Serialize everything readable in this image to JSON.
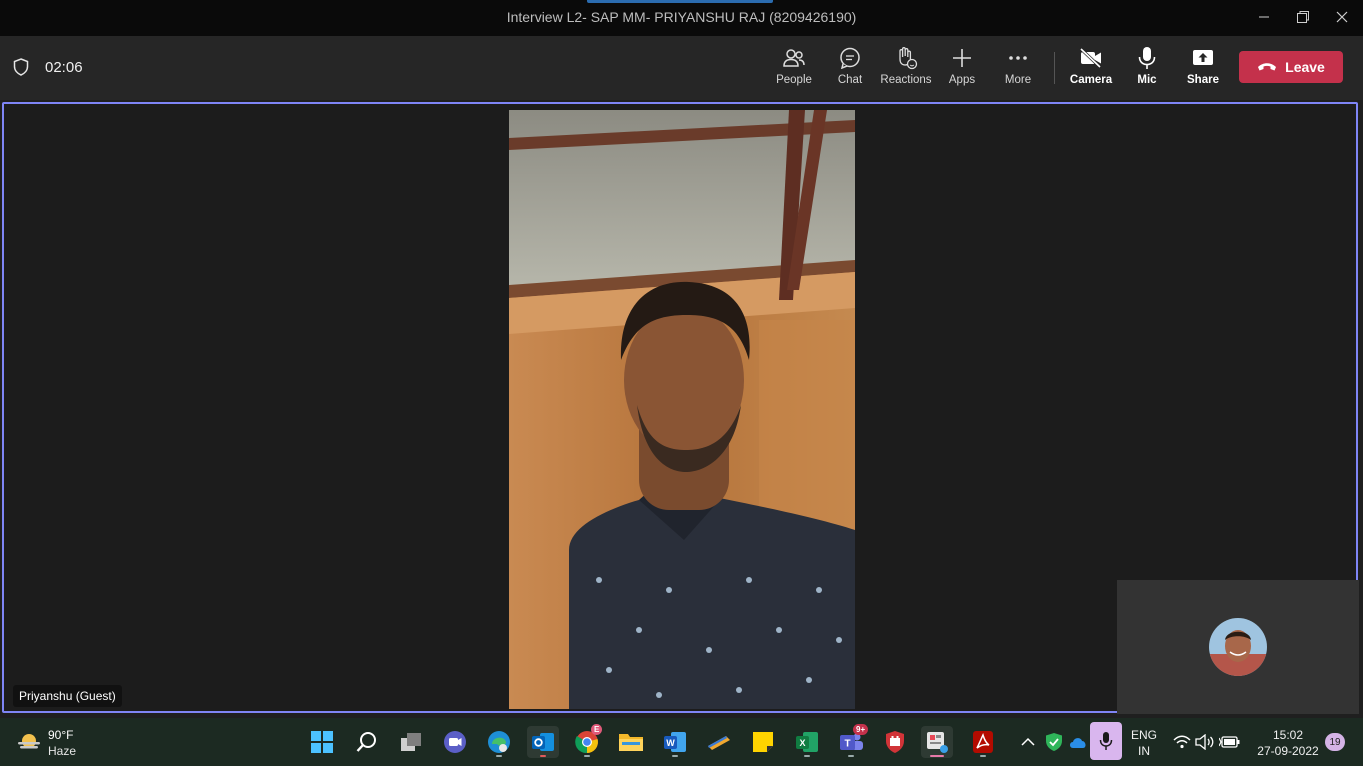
{
  "window": {
    "title": "Interview L2- SAP MM- PRIYANSHU RAJ (8209426190)"
  },
  "toolbar": {
    "timer": "02:06",
    "buttons": [
      {
        "label": "People",
        "icon": "people-icon"
      },
      {
        "label": "Chat",
        "icon": "chat-icon"
      },
      {
        "label": "Reactions",
        "icon": "reactions-icon"
      },
      {
        "label": "Apps",
        "icon": "plus-icon"
      },
      {
        "label": "More",
        "icon": "more-icon"
      }
    ],
    "media": [
      {
        "label": "Camera",
        "icon": "camera-off-icon"
      },
      {
        "label": "Mic",
        "icon": "mic-icon"
      },
      {
        "label": "Share",
        "icon": "share-icon"
      }
    ],
    "leave_label": "Leave",
    "leave_color": "#c4314b"
  },
  "stage": {
    "participant_name": "Priyanshu (Guest)",
    "active_border_color": "#7f85f5"
  },
  "taskbar": {
    "weather": {
      "temp": "90°F",
      "condition": "Haze"
    },
    "apps": [
      {
        "name": "start-button"
      },
      {
        "name": "search-button"
      },
      {
        "name": "task-view-button"
      },
      {
        "name": "teams-chat-button"
      },
      {
        "name": "edge-button"
      },
      {
        "name": "outlook-button"
      },
      {
        "name": "chrome-button",
        "badge": "E"
      },
      {
        "name": "file-explorer-button"
      },
      {
        "name": "word-button"
      },
      {
        "name": "app-button"
      },
      {
        "name": "sticky-notes-button"
      },
      {
        "name": "excel-button"
      },
      {
        "name": "teams-button",
        "badge": "9+"
      },
      {
        "name": "security-button"
      },
      {
        "name": "snipping-tool-button"
      },
      {
        "name": "acrobat-button"
      }
    ],
    "language_line1": "ENG",
    "language_line2": "IN",
    "time": "15:02",
    "date": "27-09-2022",
    "notifications": "19"
  }
}
